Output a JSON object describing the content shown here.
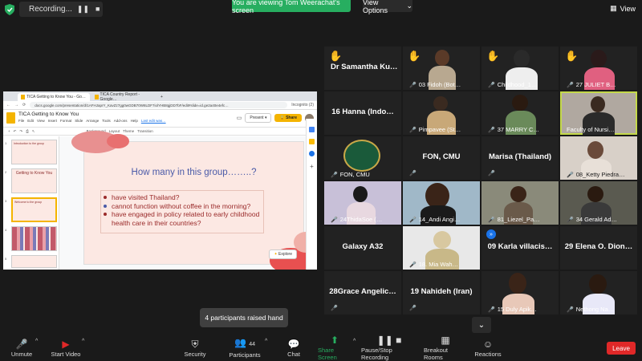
{
  "recording": {
    "label": "Recording..."
  },
  "banner": {
    "viewing": "You are viewing Tom Weerachat's screen",
    "view_options": "View Options",
    "view": "View"
  },
  "browser": {
    "tab1": "TICA Getting to Know You - Go…",
    "tab2": "TICA Country Report - Google…",
    "url": "docs.google.com/presentation/d/1AFHJaprY_KavZz7gg0wGDB70W8LDF7iolYHB8gjDD7bF/edit#slide=id.ge2a40e4efc…",
    "profile": "Incognito (2)"
  },
  "slides_app": {
    "title": "TICA Getting to Know You",
    "menu": [
      "File",
      "Edit",
      "View",
      "Insert",
      "Format",
      "Slide",
      "Arrange",
      "Tools",
      "Add-ons",
      "Help",
      "Last edit was…"
    ],
    "present": "Present",
    "share": "Share",
    "toolbar": [
      "Background",
      "Layout",
      "Theme",
      "Transition"
    ],
    "explore": "Explore",
    "thumb2_title": "Getting to Know You",
    "thumb1_text": "Introduction to the group",
    "thumb3_text": "Welcome to the group"
  },
  "slide": {
    "title": "How many in this group……..?",
    "bullets": [
      "have visited Thailand?",
      "cannot function without coffee in the morning?",
      "have engaged in policy related to early childhood health care in their countries?"
    ]
  },
  "participants_grid": [
    {
      "name": "Dr Samantha Ku…"
    },
    {
      "name": "03 Fidoh (Bot…"
    },
    {
      "name": "Childhood_1…"
    },
    {
      "name": "27 JULIET B…"
    },
    {
      "name": "16 Hanna (Indo…"
    },
    {
      "name": "Pimpavee (St…"
    },
    {
      "name": "37 MARRY C…"
    },
    {
      "name": "Faculty of Nursi…"
    },
    {
      "name": "FON, CMU"
    },
    {
      "name": "FON, CMU"
    },
    {
      "name": "Marisa (Thailand)"
    },
    {
      "name": "08_Ketty Piedra…"
    },
    {
      "name": "24ThidaSoe (…"
    },
    {
      "name": "14_Andi Angi…"
    },
    {
      "name": "81_Liezel_Pa…"
    },
    {
      "name": "34 Gerald Ad…"
    },
    {
      "name": "Galaxy A32"
    },
    {
      "name": "18. Mia Wah…"
    },
    {
      "name": "09 Karla villacis…"
    },
    {
      "name": "29 Elena O. Dion…"
    },
    {
      "name": "28Grace Angelic…"
    },
    {
      "name": "19 Nahideh (Iran)"
    },
    {
      "name": "15 Duly Apik…"
    },
    {
      "name": "Nethong Na…"
    }
  ],
  "tooltip": "4 participants raised hand",
  "participants_count": "44",
  "toolbar": {
    "unmute": "Unmute",
    "start_video": "Start Video",
    "security": "Security",
    "participants": "Participants",
    "chat": "Chat",
    "share_screen": "Share Screen",
    "record": "Pause/Stop Recording",
    "breakout": "Breakout Rooms",
    "reactions": "Reactions",
    "leave": "Leave"
  },
  "colors": {
    "green": "#27ae60",
    "red": "#e02828",
    "speaker": "#c4d94a",
    "slide_bg": "#fce8e3"
  }
}
